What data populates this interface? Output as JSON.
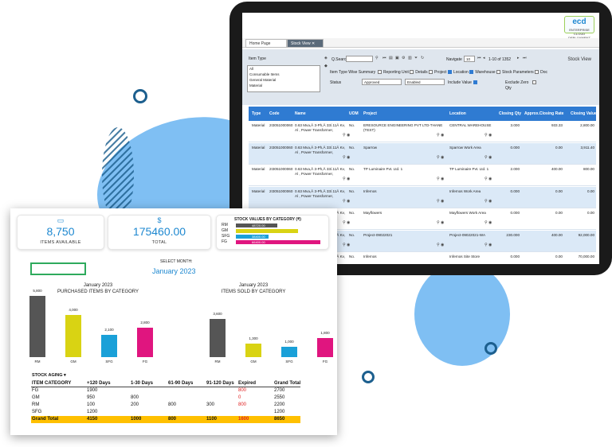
{
  "tablet": {
    "brand": "ecd",
    "brand_sub": "ENTERPRISE CLOUD DEPLOYMENT",
    "tabs": [
      "Home Page",
      "Stock View"
    ],
    "screen_title": "Stock View",
    "filters": {
      "item_type_label": "Item Type",
      "item_types": [
        "All",
        "Consumable Items",
        "General Material",
        "Material"
      ],
      "qsearch_label": "Q.Search",
      "navigate_label": "Navigate",
      "page_size": "10",
      "page_info": "1-10 of 1352",
      "item_type_summary": "Item Type Wise Summary",
      "checks": [
        {
          "label": "Reporting Unit",
          "on": false
        },
        {
          "label": "Details",
          "on": false
        },
        {
          "label": "Project",
          "on": false
        },
        {
          "label": "Location",
          "on": true
        },
        {
          "label": "Warehouse",
          "on": true
        },
        {
          "label": "Stock Parameters",
          "on": false
        },
        {
          "label": "Doc",
          "on": false
        }
      ],
      "status_label": "Status",
      "status_value": "Approved",
      "enabled_value": "Enabled",
      "include_value_label": "Include Value",
      "exclude_zero_label": "Exclude Zero Qty"
    },
    "columns": [
      "Type",
      "Code",
      "Name",
      "UOM",
      "Project",
      "Location",
      "Closing Qty",
      "Approx.Closing Rate",
      "Closing Value"
    ],
    "rows": [
      {
        "type": "Material",
        "code": "2I3051000060",
        "name": "0.63 Mva,Â 3-Ph,Â 33/.11Â Kv, Al , Power Transformer,",
        "uom": "No.",
        "project": "ERESOURCE ENGINEERING PVT LTD-THANE (TEST)",
        "location": "CENTRAL WAREHOUSE",
        "qty": "3.000",
        "rate": "933.33",
        "value": "2,800.00"
      },
      {
        "type": "Material",
        "code": "2I3051000060",
        "name": "0.63 Mva,Â 3-Ph,Â 33/.11Â Kv, Al , Power Transformer,",
        "uom": "No.",
        "project": "Sparrow",
        "location": "Sparrow Work Area",
        "qty": "0.000",
        "rate": "0.00",
        "value": "3,911.40"
      },
      {
        "type": "Material",
        "code": "2I3051000060",
        "name": "0.63 Mva,Â 3-Ph,Â 33/.11Â Kv, Al , Power Transformer,",
        "uom": "No.",
        "project": "TP Luminaire Pvt. Ltd. 1",
        "location": "TP Luminaire Pvt. Ltd. 1",
        "qty": "2.000",
        "rate": "400.00",
        "value": "800.00"
      },
      {
        "type": "Material",
        "code": "2I3051000060",
        "name": "0.63 Mva,Â 3-Ph,Â 33/.11Â Kv, Al , Power Transformer,",
        "uom": "No.",
        "project": "Infernos",
        "location": "Infernos Work Area",
        "qty": "0.000",
        "rate": "0.00",
        "value": "0.00"
      },
      {
        "type": "Material",
        "code": "2I3051000060",
        "name": "0.63 Mva,Â 3-Ph,Â 33/.11Â Kv, Al , Power Transformer,",
        "uom": "No.",
        "project": "Mayflowers",
        "location": "Mayflowers Work Area",
        "qty": "0.000",
        "rate": "0.00",
        "value": "0.00"
      },
      {
        "type": "Material",
        "code": "2I3051000060",
        "name": "0.63 Mva,Â 3-Ph,Â 33/.11Â Kv, Al , Power Transformer,",
        "uom": "No.",
        "project": "Project-09022021",
        "location": "Project-09022021-WA",
        "qty": "230.000",
        "rate": "400.00",
        "value": "92,000.00"
      },
      {
        "type": "Material",
        "code": "2I3051000060",
        "name": "0.63 Mva,Â 3-Ph,Â 33/.11Â Kv, Al , Power Transformer,",
        "uom": "No.",
        "project": "Infernos",
        "location": "Infernos Site Store",
        "qty": "0.000",
        "rate": "0.00",
        "value": "70,000.00"
      }
    ]
  },
  "dashboard": {
    "kpi_items": {
      "value": "8,750",
      "label": "ITEMS AVAILABLE"
    },
    "kpi_total": {
      "value": "175460.00",
      "label": "TOTAL"
    },
    "stock_by_category": {
      "title": "STOCK VALUES BY CATEGORY (₹)",
      "rows": [
        {
          "label": "RM",
          "value": "48720.00",
          "color": "#555555",
          "frac": 0.49
        },
        {
          "label": "GM",
          "value": "",
          "color": "#d9d313",
          "frac": 0.74
        },
        {
          "label": "SFG",
          "value": "38400.00",
          "color": "#1aa0d8",
          "frac": 0.39
        },
        {
          "label": "FG",
          "value": "66400.00",
          "color": "#e0157f",
          "frac": 1.0
        }
      ]
    },
    "select_month_label": "SELECT MONTH:",
    "selected_month": "January 2023",
    "aging": {
      "title": "STOCK AGING",
      "headers": [
        "ITEM CATEGORY",
        "+120 Days",
        "1-30 Days",
        "61-90 Days",
        "91-120 Days",
        "Expired",
        "Grand Total"
      ],
      "rows": [
        [
          "FG",
          "1900",
          "",
          "",
          "",
          "800",
          "2700"
        ],
        [
          "GM",
          "950",
          "800",
          "",
          "",
          "0",
          "2550"
        ],
        [
          "RM",
          "100",
          "200",
          "800",
          "300",
          "800",
          "2200"
        ],
        [
          "SFG",
          "1200",
          "",
          "",
          "",
          "",
          "1200"
        ]
      ],
      "total": [
        "Grand Total",
        "4150",
        "1000",
        "800",
        "1100",
        "1600",
        "8650"
      ]
    }
  },
  "chart_data": [
    {
      "type": "bar",
      "title": "January 2023",
      "subtitle": "PURCHASED ITEMS BY CATEGORY",
      "categories": [
        "RM",
        "GM",
        "SFG",
        "FG"
      ],
      "values": [
        5800,
        4000,
        2100,
        2800
      ],
      "value_labels": [
        "5,800",
        "4,000",
        "2,100",
        "2,800"
      ],
      "colors": [
        "#555555",
        "#d9d313",
        "#1aa0d8",
        "#e0157f"
      ],
      "ylim": [
        0,
        6000
      ]
    },
    {
      "type": "bar",
      "title": "January 2023",
      "subtitle": "ITEMS SOLD BY CATEGORY",
      "categories": [
        "RM",
        "GM",
        "SFG",
        "FG"
      ],
      "values": [
        3600,
        1300,
        1000,
        1800
      ],
      "value_labels": [
        "3,600",
        "1,300",
        "1,000",
        "1,800"
      ],
      "colors": [
        "#555555",
        "#d9d313",
        "#1aa0d8",
        "#e0157f"
      ],
      "ylim": [
        0,
        6000
      ]
    }
  ]
}
